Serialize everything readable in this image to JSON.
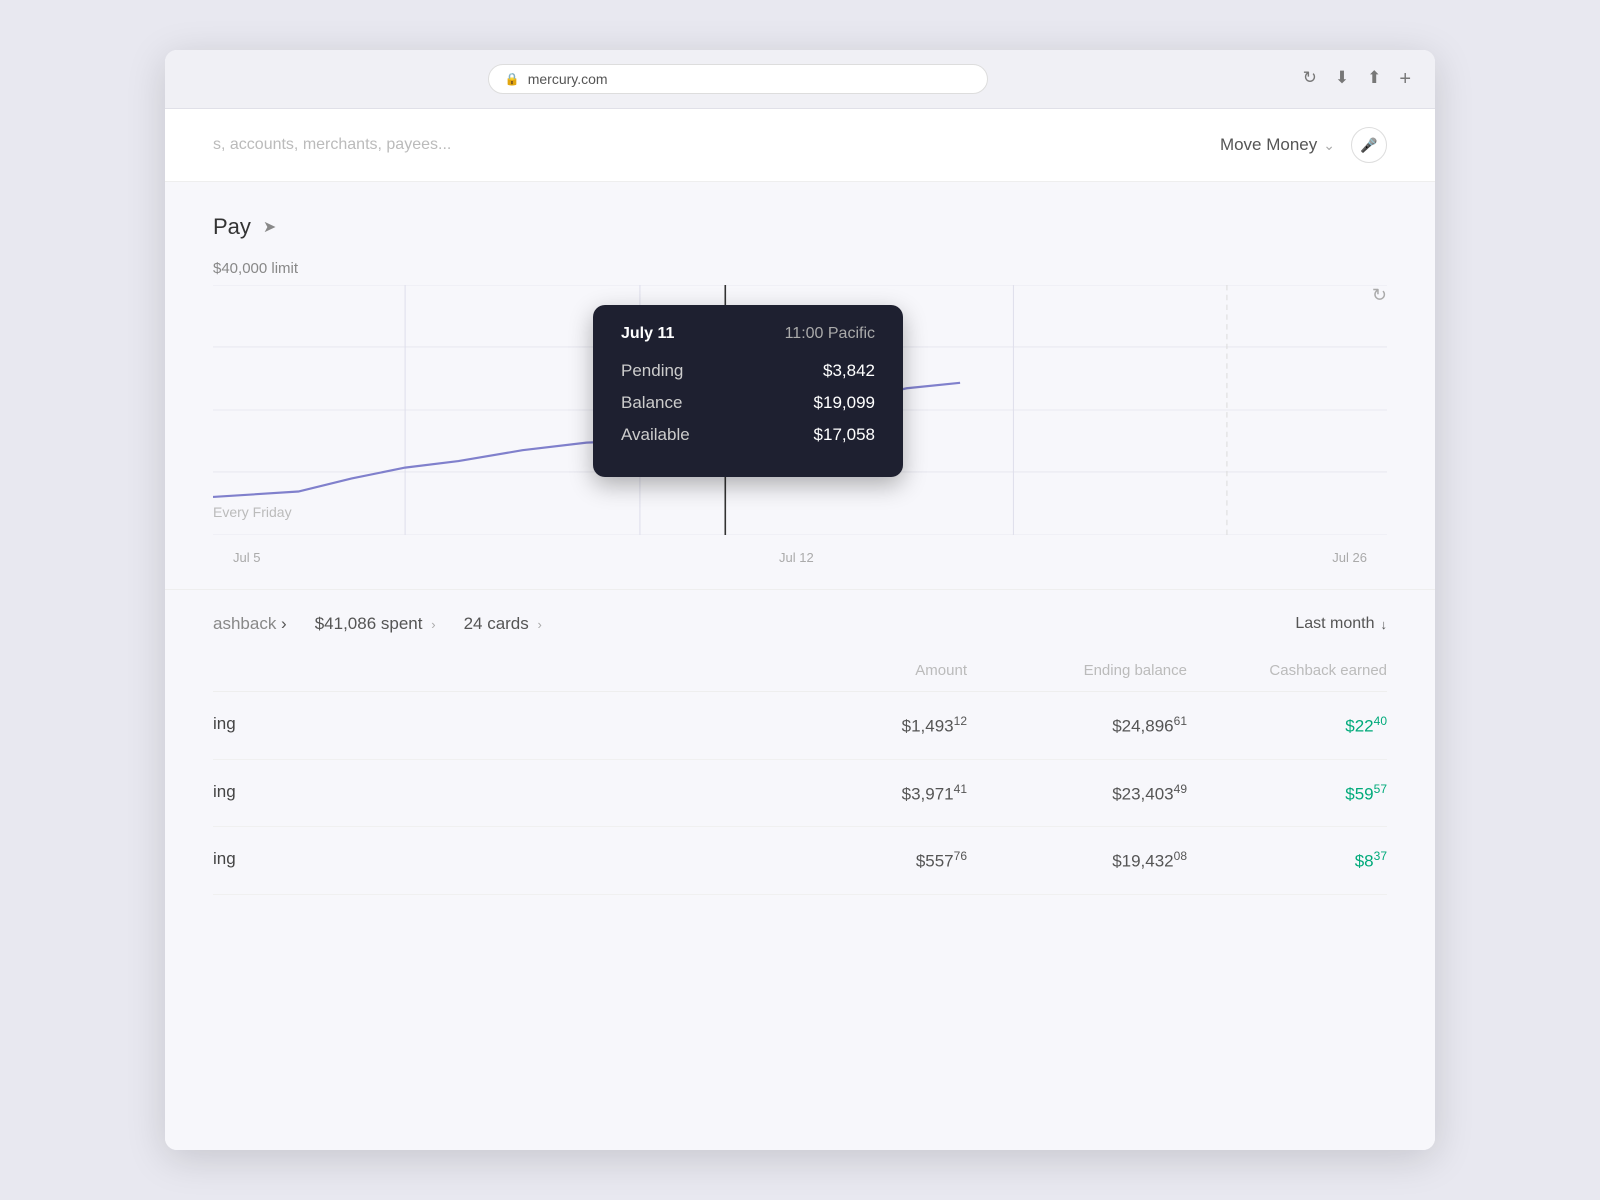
{
  "browser": {
    "url": "mercury.com",
    "lock_icon": "🔒",
    "reload_icon": "↻",
    "download_icon": "⬇",
    "share_icon": "⬆",
    "add_tab_icon": "+"
  },
  "nav": {
    "search_placeholder": "s, accounts, merchants, payees...",
    "move_money_label": "Move Money",
    "move_money_chevron": "⌄",
    "mic_icon": "🎤"
  },
  "chart": {
    "pay_label": "Pay",
    "send_icon": "➤",
    "limit_label": "$40,000 limit",
    "every_friday_label": "Every Friday",
    "refresh_icon": "↻",
    "x_labels": [
      "Jul 5",
      "Jul 12",
      "Jul 26"
    ],
    "tooltip": {
      "date": "July 11",
      "time": "11:00 Pacific",
      "rows": [
        {
          "label": "Pending",
          "value": "$3,842"
        },
        {
          "label": "Balance",
          "value": "$19,099"
        },
        {
          "label": "Available",
          "value": "$17,058"
        }
      ]
    }
  },
  "cards_section": {
    "cashback_label": "ashback",
    "cashback_chevron": "›",
    "spent_label": "$41,086 spent",
    "spent_chevron": "›",
    "cards_label": "24 cards",
    "cards_chevron": "›",
    "last_month_label": "Last month",
    "last_month_icon": "↓"
  },
  "table": {
    "headers": [
      "",
      "Amount",
      "Ending balance",
      "Cashback earned"
    ],
    "rows": [
      {
        "name": "ing",
        "amount_main": "$1,493",
        "amount_sup": "12",
        "ending_main": "$24,896",
        "ending_sup": "61",
        "cashback_main": "$22",
        "cashback_sup": "40"
      },
      {
        "name": "ing",
        "amount_main": "$3,971",
        "amount_sup": "41",
        "ending_main": "$23,403",
        "ending_sup": "49",
        "cashback_main": "$59",
        "cashback_sup": "57"
      },
      {
        "name": "ing",
        "amount_main": "$557",
        "amount_sup": "76",
        "ending_main": "$19,432",
        "ending_sup": "08",
        "cashback_main": "$8",
        "cashback_sup": "37"
      }
    ]
  }
}
